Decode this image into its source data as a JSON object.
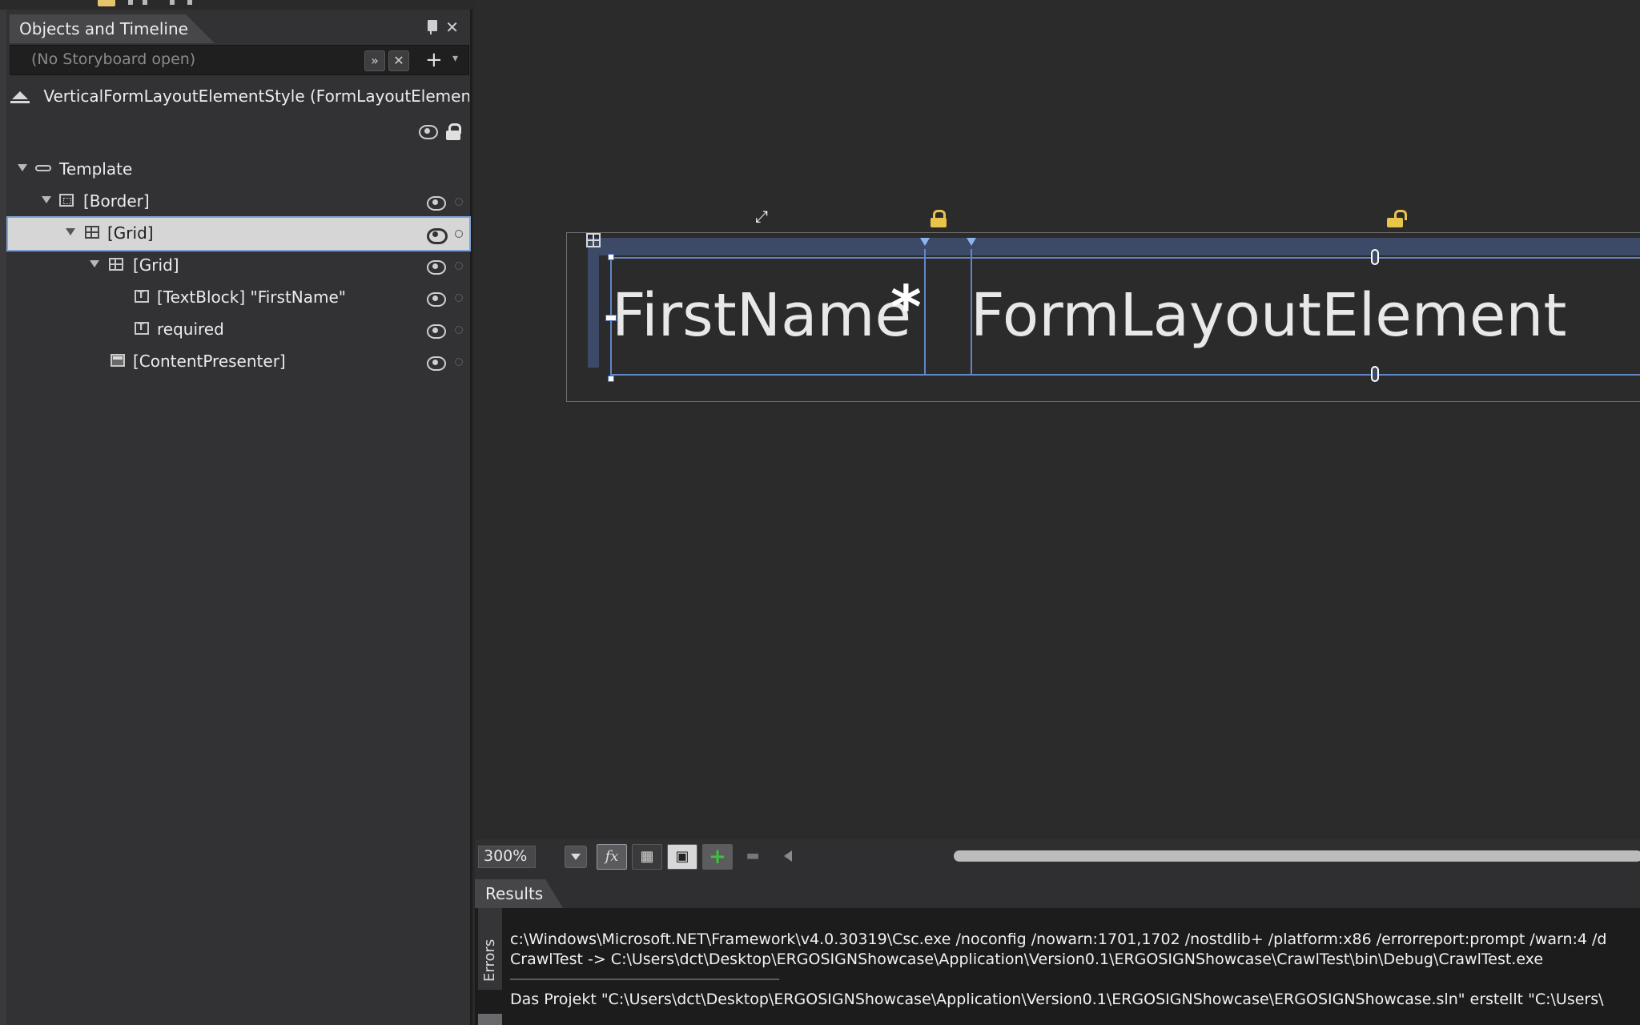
{
  "objects_panel": {
    "title": "Objects and Timeline",
    "storyboard_placeholder": "(No Storyboard open)",
    "style_name": "VerticalFormLayoutElementStyle (FormLayoutElement...",
    "tree": [
      {
        "label": "Template",
        "icon": "template-icon",
        "depth": 0,
        "expanded": true
      },
      {
        "label": "[Border]",
        "icon": "border-icon",
        "depth": 1,
        "expanded": true
      },
      {
        "label": "[Grid]",
        "icon": "grid-icon",
        "depth": 2,
        "expanded": true,
        "selected": true
      },
      {
        "label": "[Grid]",
        "icon": "grid-icon",
        "depth": 3,
        "expanded": true
      },
      {
        "label": "[TextBlock] \"FirstName\"",
        "icon": "textblock-icon",
        "depth": 4
      },
      {
        "label": "required",
        "icon": "textblock-icon",
        "depth": 4
      },
      {
        "label": "[ContentPresenter]",
        "icon": "contentpresenter-icon",
        "depth": 3
      }
    ]
  },
  "canvas": {
    "label_text": "FirstName",
    "required_mark": "*",
    "content_text": "FormLayoutElement"
  },
  "toolbar": {
    "zoom": "300%",
    "fx_label": "fx"
  },
  "results": {
    "title": "Results",
    "errors_tab": "Errors",
    "lines": [
      "c:\\Windows\\Microsoft.NET\\Framework\\v4.0.30319\\Csc.exe /noconfig /nowarn:1701,1702 /nostdlib+ /platform:x86 /errorreport:prompt /warn:4 /d",
      "CrawlTest -> C:\\Users\\dct\\Desktop\\ERGOSIGNShowcase\\Application\\Version0.1\\ERGOSIGNShowcase\\CrawlTest\\bin\\Debug\\CrawlTest.exe",
      "________________________________________________",
      "Das Projekt \"C:\\Users\\dct\\Desktop\\ERGOSIGNShowcase\\Application\\Version0.1\\ERGOSIGNShowcase\\ERGOSIGNShowcase.sln\" erstellt \"C:\\Users\\"
    ]
  },
  "colors": {
    "selection_guide": "#5f86c9",
    "selected_row": "#d6d6d6",
    "lock_yellow": "#e8c44a"
  }
}
